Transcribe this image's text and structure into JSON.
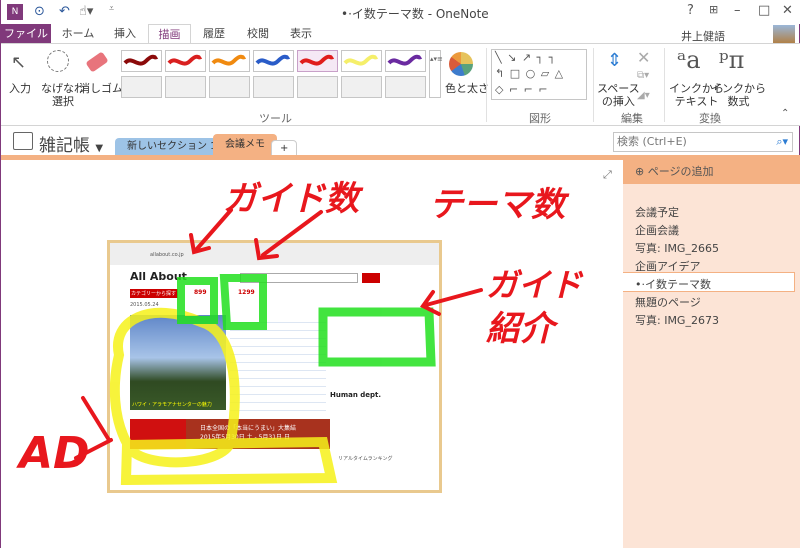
{
  "window": {
    "title": "•·イ数テーマ数 - OneNote",
    "user": "井上健語",
    "help": "?",
    "minimize": "–",
    "maximize": "□",
    "close": "✕"
  },
  "quick_access": {
    "app_icon": "onenote-icon",
    "back": "back-icon",
    "undo": "undo-icon",
    "touch": "touch-mode-icon",
    "customize": "customize-icon"
  },
  "tabs": [
    {
      "label": "ファイル"
    },
    {
      "label": "ホーム"
    },
    {
      "label": "挿入"
    },
    {
      "label": "描画"
    },
    {
      "label": "履歴"
    },
    {
      "label": "校閲"
    },
    {
      "label": "表示"
    }
  ],
  "active_tab": "描画",
  "ribbon": {
    "input": "入力",
    "lasso": [
      "なげなわ",
      "選択"
    ],
    "eraser": "消しゴム",
    "pens": [
      "#8b0a0a",
      "#d92020",
      "#f08a10",
      "#2a5cc8",
      "#e01c1c",
      "#f5ef6a",
      "#6a2aa0"
    ],
    "color_size": "色と太さ",
    "tools_group": "ツール",
    "shapes_rows": [
      "╲ ↘ ↗ ┐ ┐",
      "↰ □ ○ ▱ △",
      "◇ ⌐ ⌐ ⌐"
    ],
    "shapes_group": "図形",
    "insert_space": [
      "スペース",
      "の挿入"
    ],
    "edit_group": "編集",
    "ink_to_text": [
      "インクから",
      "テキスト"
    ],
    "ink_to_math": [
      "インクから",
      "数式"
    ],
    "convert_group": "変換"
  },
  "notebook": {
    "name": "雑記帳",
    "sections": [
      "新しいセクション 1",
      "会議メモ",
      "+"
    ],
    "search_placeholder": "検索 (Ctrl+E)"
  },
  "pages": {
    "add": "ページの追加",
    "items": [
      "会議予定",
      "企画会議",
      "写真: IMG_2665",
      "企画アイデア",
      "•·イ数テーマ数",
      "無題のページ",
      "写真: IMG_2673"
    ],
    "selected_index": 4
  },
  "ink_annotations": {
    "guides": "ガイド数",
    "themes": "テーマ数",
    "guide_intro": [
      "ガイド",
      "紹介"
    ],
    "ad": "AD",
    "color": "#e8171d",
    "highlight_green": "#22e01e",
    "highlight_yellow": "#f6f21a"
  },
  "embedded_screenshot": {
    "url": "allabout.co.jp",
    "logo": "All About",
    "category_button": "カテゴリーから探す",
    "guide_count": "899",
    "theme_count": "1299",
    "date": "2015.05.24",
    "hero_caption": "ハワイ・アラモアナセンターの魅力",
    "human_dept": "Human dept.",
    "banner_title": "日本全国の「本当にうまい」大集結",
    "banner_date": "2015年5月30日 土 - 5月31日 日",
    "ranking": "リアルタイムランキング"
  }
}
